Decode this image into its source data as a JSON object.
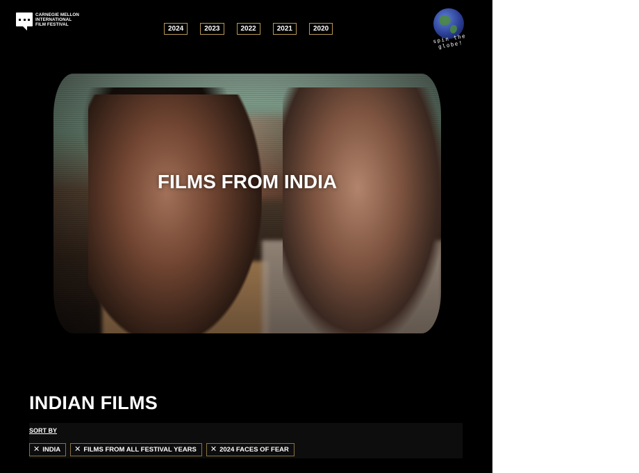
{
  "header": {
    "logo_lines": [
      "CARNEGIE MELLON",
      "INTERNATIONAL",
      "FILM FESTIVAL"
    ],
    "years": [
      "2024",
      "2023",
      "2022",
      "2021",
      "2020"
    ],
    "globe_caption": "spin the globe!"
  },
  "hero": {
    "title": "FILMS FROM INDIA"
  },
  "section": {
    "title": "INDIAN FILMS",
    "sort_label": "SORT BY",
    "filters": [
      {
        "icon": "close-icon",
        "label": "INDIA"
      },
      {
        "icon": "close-icon",
        "label": "FILMS FROM ALL FESTIVAL YEARS"
      },
      {
        "icon": "close-icon",
        "label": "2024 FACES OF FEAR"
      }
    ]
  },
  "colors": {
    "background": "#000000",
    "accent_border": "#b89a52"
  }
}
